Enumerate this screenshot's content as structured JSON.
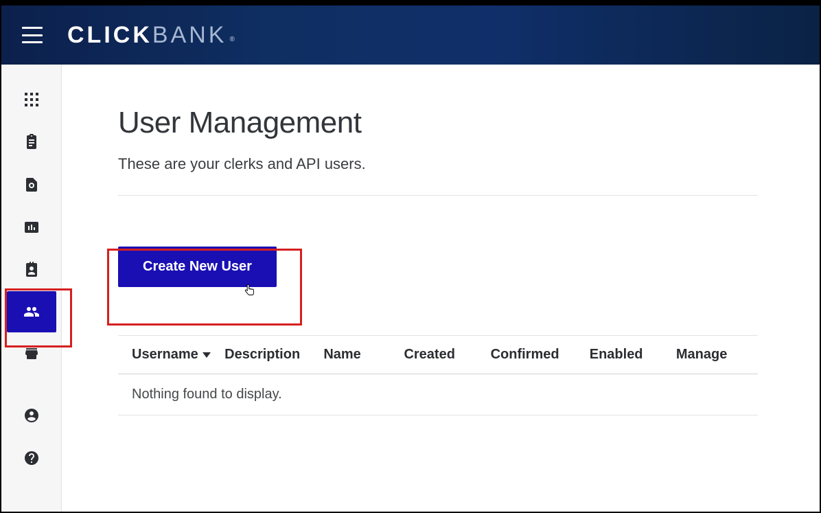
{
  "brand": {
    "part1": "CLICK",
    "part2": "BANK"
  },
  "sidebar": {
    "items": [
      {
        "name": "apps-icon"
      },
      {
        "name": "clipboard-icon"
      },
      {
        "name": "search-doc-icon"
      },
      {
        "name": "chart-icon"
      },
      {
        "name": "id-badge-icon"
      },
      {
        "name": "users-icon",
        "active": true
      },
      {
        "name": "store-icon"
      },
      {
        "name": "account-icon"
      },
      {
        "name": "help-icon"
      }
    ]
  },
  "page": {
    "title": "User Management",
    "subtitle": "These are your clerks and API users."
  },
  "actions": {
    "create_user_label": "Create New User"
  },
  "table": {
    "columns": {
      "username": "Username",
      "description": "Description",
      "name": "Name",
      "created": "Created",
      "confirmed": "Confirmed",
      "enabled": "Enabled",
      "manage": "Manage"
    },
    "sort_column": "username",
    "sort_direction": "desc",
    "rows": [],
    "empty_message": "Nothing found to display."
  }
}
